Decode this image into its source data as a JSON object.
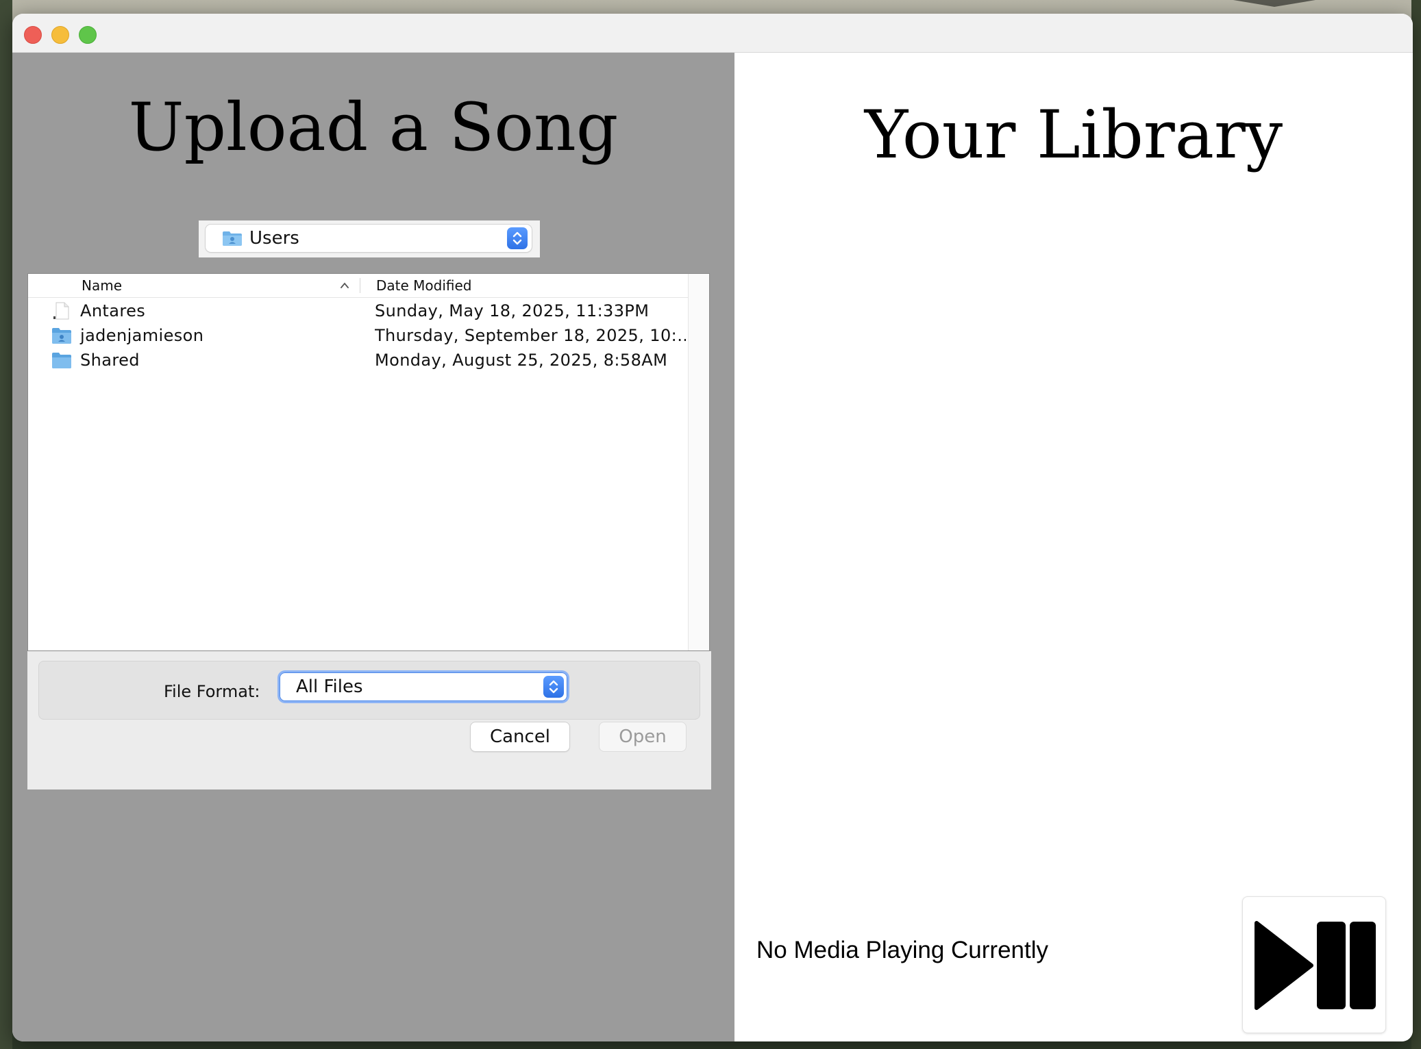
{
  "window": {
    "controls": [
      "close",
      "minimize",
      "zoom"
    ]
  },
  "upload_panel": {
    "title": "Upload a Song",
    "folder_selector": {
      "value": "Users",
      "icon": "user-folder-icon"
    },
    "file_table": {
      "columns": [
        "Name",
        "Date Modified"
      ],
      "sort": {
        "column": "Name",
        "direction": "ascending"
      },
      "rows": [
        {
          "icon": "document-icon",
          "name": "Antares",
          "date": "Sunday, May 18, 2025, 11:33PM"
        },
        {
          "icon": "user-folder-icon",
          "name": "jadenjamieson",
          "date": "Thursday, September 18, 2025, 10:…"
        },
        {
          "icon": "folder-icon",
          "name": "Shared",
          "date": "Monday, August 25, 2025, 8:58AM"
        }
      ]
    },
    "file_format": {
      "label": "File Format:",
      "value": "All Files"
    },
    "buttons": {
      "cancel": "Cancel",
      "open": "Open"
    }
  },
  "library_panel": {
    "title": "Your Library",
    "now_playing": "No Media Playing Currently",
    "play_pause_icon": "play-pause-icon"
  },
  "colors": {
    "left_panel_bg": "#9b9b9b",
    "right_panel_bg": "#ffffff",
    "accent": "#3b82f6"
  }
}
